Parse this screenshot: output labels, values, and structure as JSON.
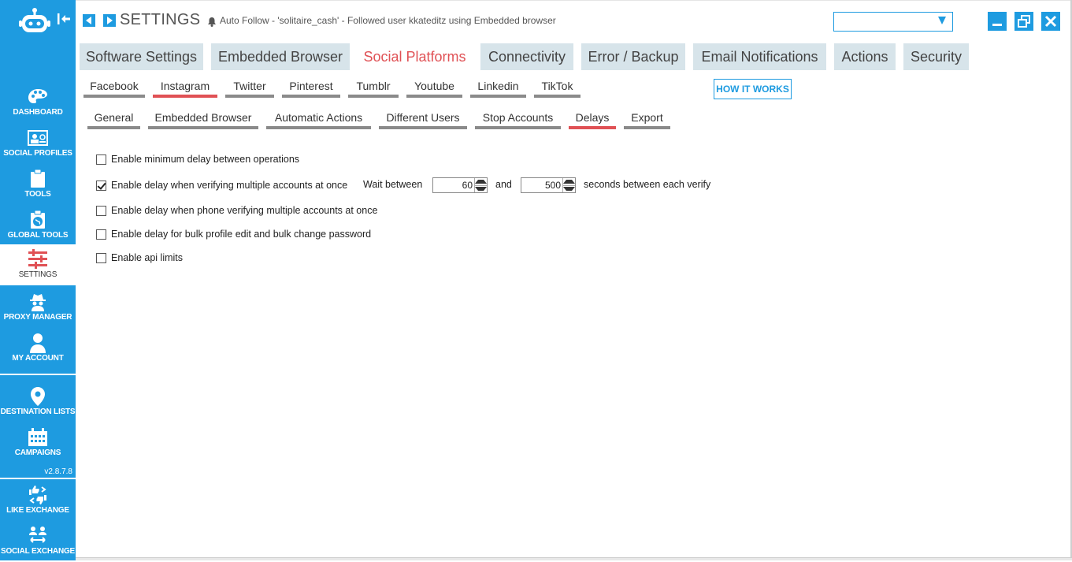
{
  "colors": {
    "accent": "#1e9be0",
    "active_tab_text": "#e05155",
    "tab_bg": "#d7e4ea",
    "underline": "#8a8a8a"
  },
  "sidebar": {
    "items": [
      {
        "label": "DASHBOARD",
        "icon": "palette-icon"
      },
      {
        "label": "SOCIAL PROFILES",
        "icon": "id-card-icon"
      },
      {
        "label": "TOOLS",
        "icon": "clipboard-icon"
      },
      {
        "label": "GLOBAL TOOLS",
        "icon": "globe-clipboard-icon"
      },
      {
        "label": "SETTINGS",
        "icon": "sliders-icon"
      },
      {
        "label": "PROXY MANAGER",
        "icon": "spy-icon"
      },
      {
        "label": "MY ACCOUNT",
        "icon": "user-icon"
      },
      {
        "label": "DESTINATION LISTS",
        "icon": "map-pin-icon"
      },
      {
        "label": "CAMPAIGNS",
        "icon": "calendar-icon"
      },
      {
        "label": "LIKE EXCHANGE",
        "icon": "thumbs-exchange-icon"
      },
      {
        "label": "SOCIAL EXCHANGE",
        "icon": "people-exchange-icon"
      }
    ],
    "version": "v2.8.7.8"
  },
  "header": {
    "title": "SETTINGS",
    "notification": "Auto Follow - 'solitaire_cash' - Followed user kkateditz using Embedded browser"
  },
  "main_tabs": [
    "Software Settings",
    "Embedded Browser",
    "Social Platforms",
    "Connectivity",
    "Error / Backup",
    "Email Notifications",
    "Actions",
    "Security"
  ],
  "platform_tabs": [
    "Facebook",
    "Instagram",
    "Twitter",
    "Pinterest",
    "Tumblr",
    "Youtube",
    "Linkedin",
    "TikTok"
  ],
  "section_tabs": [
    "General",
    "Embedded Browser",
    "Automatic Actions",
    "Different Users",
    "Stop Accounts",
    "Delays",
    "Export"
  ],
  "how_it_works": "HOW IT WORKS",
  "options": [
    {
      "label": "Enable minimum delay between operations",
      "checked": false
    },
    {
      "label": "Enable delay when verifying multiple accounts at once",
      "checked": true
    },
    {
      "label": "Enable delay when phone verifying multiple accounts at once",
      "checked": false
    },
    {
      "label": "Enable delay for bulk profile edit and bulk change password",
      "checked": false
    },
    {
      "label": "Enable api limits",
      "checked": false
    }
  ],
  "verify_delay": {
    "wait_label": "Wait between",
    "min": "60",
    "and_label": "and",
    "max": "500",
    "suffix": "seconds between each verify"
  }
}
